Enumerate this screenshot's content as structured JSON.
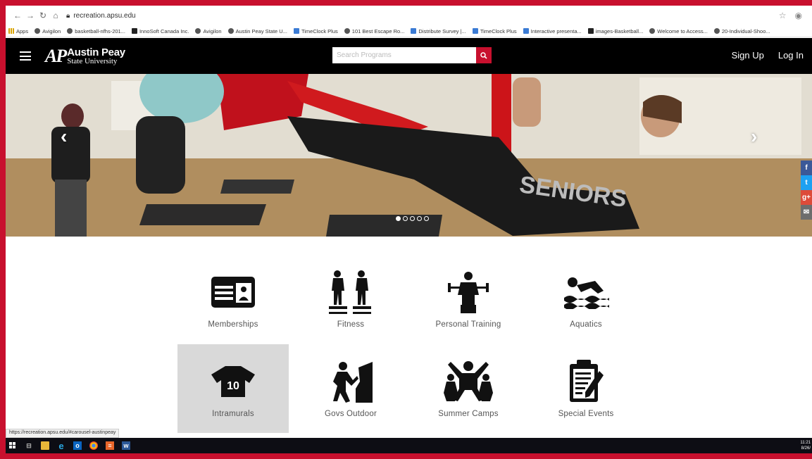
{
  "browser": {
    "url": "recreation.apsu.edu",
    "bookmarks": [
      "Apps",
      "Avigilon",
      "basketball-nfhs-201...",
      "InnoSoft Canada Inc.",
      "Avigilon",
      "Austin Peay State U...",
      "TimeClock Plus",
      "101 Best Escape Ro...",
      "Distribute Survey |...",
      "TimeClock Plus",
      "Interactive presenta...",
      "images-Basketball...",
      "Welcome to Access...",
      "20-Individual-Shoo..."
    ]
  },
  "header": {
    "logo_mark": "AP",
    "logo_line1": "Austin Peay",
    "logo_line2": "State University",
    "search_placeholder": "Search Programs",
    "sign_up": "Sign Up",
    "log_in": "Log In"
  },
  "social": {
    "facebook": "f",
    "twitter": "t",
    "google": "g+",
    "email": "✉"
  },
  "programs": [
    {
      "label": "Memberships",
      "icon": "id-card-icon"
    },
    {
      "label": "Fitness",
      "icon": "fitness-icon"
    },
    {
      "label": "Personal Training",
      "icon": "personal-training-icon"
    },
    {
      "label": "Aquatics",
      "icon": "swimmer-icon"
    },
    {
      "label": "Intramurals",
      "icon": "jersey-icon",
      "jersey_number": "10"
    },
    {
      "label": "Govs Outdoor",
      "icon": "climber-icon"
    },
    {
      "label": "Summer Camps",
      "icon": "kids-icon"
    },
    {
      "label": "Special Events",
      "icon": "clipboard-icon"
    }
  ],
  "status_url": "https://recreation.apsu.edu/#carousel-austinpeay",
  "taskbar": {
    "time": "11:21",
    "date": "8/26/"
  },
  "colors": {
    "brand_red": "#c8102e",
    "header_black": "#000000",
    "tile_highlight": "#d9d9d9"
  }
}
